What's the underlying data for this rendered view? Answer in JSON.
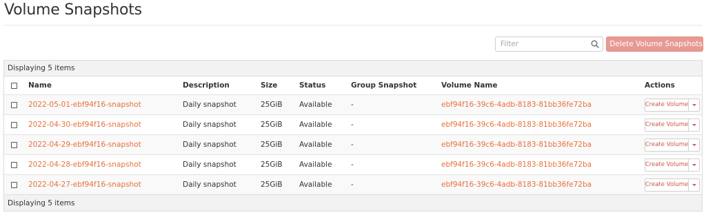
{
  "page": {
    "title": "Volume Snapshots"
  },
  "toolbar": {
    "filter_placeholder": "Filter",
    "search_icon": "search-icon",
    "delete_label": "Delete Volume Snapshots",
    "delete_icon": "trash-icon",
    "delete_color": "#e79a93"
  },
  "table": {
    "count_top": "Displaying 5 items",
    "count_bottom": "Displaying 5 items",
    "columns": {
      "name": "Name",
      "description": "Description",
      "size": "Size",
      "status": "Status",
      "group_snapshot": "Group Snapshot",
      "volume_name": "Volume Name",
      "actions": "Actions"
    },
    "rows": [
      {
        "name": "2022-05-01-ebf94f16-snapshot",
        "description": "Daily snapshot",
        "size": "25GiB",
        "status": "Available",
        "group_snapshot": "-",
        "volume_name": "ebf94f16-39c6-4adb-8183-81bb36fe72ba",
        "action": "Create Volume"
      },
      {
        "name": "2022-04-30-ebf94f16-snapshot",
        "description": "Daily snapshot",
        "size": "25GiB",
        "status": "Available",
        "group_snapshot": "-",
        "volume_name": "ebf94f16-39c6-4adb-8183-81bb36fe72ba",
        "action": "Create Volume"
      },
      {
        "name": "2022-04-29-ebf94f16-snapshot",
        "description": "Daily snapshot",
        "size": "25GiB",
        "status": "Available",
        "group_snapshot": "-",
        "volume_name": "ebf94f16-39c6-4adb-8183-81bb36fe72ba",
        "action": "Create Volume"
      },
      {
        "name": "2022-04-28-ebf94f16-snapshot",
        "description": "Daily snapshot",
        "size": "25GiB",
        "status": "Available",
        "group_snapshot": "-",
        "volume_name": "ebf94f16-39c6-4adb-8183-81bb36fe72ba",
        "action": "Create Volume"
      },
      {
        "name": "2022-04-27-ebf94f16-snapshot",
        "description": "Daily snapshot",
        "size": "25GiB",
        "status": "Available",
        "group_snapshot": "-",
        "volume_name": "ebf94f16-39c6-4adb-8183-81bb36fe72ba",
        "action": "Create Volume"
      }
    ]
  },
  "colors": {
    "link": "#e8703a",
    "action_text": "#c9584c"
  }
}
